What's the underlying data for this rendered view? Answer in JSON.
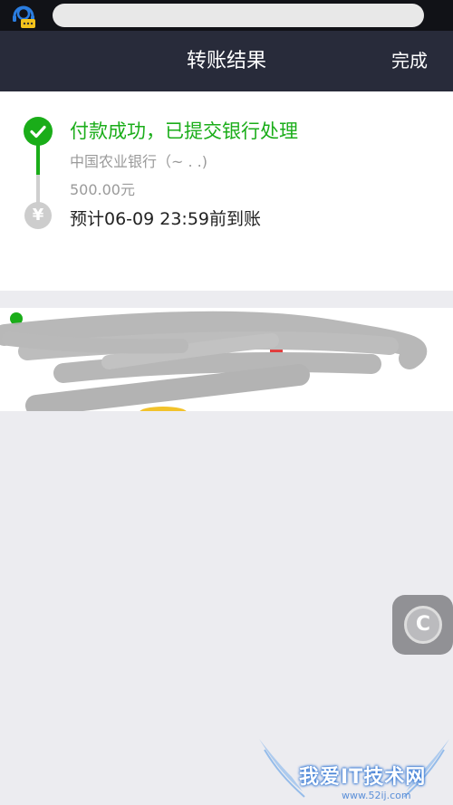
{
  "status_bar": {
    "app_icon": "support-agent-icon"
  },
  "nav": {
    "title": "转账结果",
    "done_label": "完成"
  },
  "result": {
    "title": "付款成功，已提交银行处理",
    "bank": "中国农业银行（~ . .)",
    "amount": "500.00元",
    "eta": "预计06-09 23:59前到账",
    "success_color": "#1aad19",
    "icons": [
      "check-icon",
      "yen-icon"
    ]
  },
  "floating": {
    "label": "C",
    "icon": "clean-button-icon"
  },
  "watermark": {
    "text": "我爱IT技术网",
    "url": "www.52ij.com"
  }
}
